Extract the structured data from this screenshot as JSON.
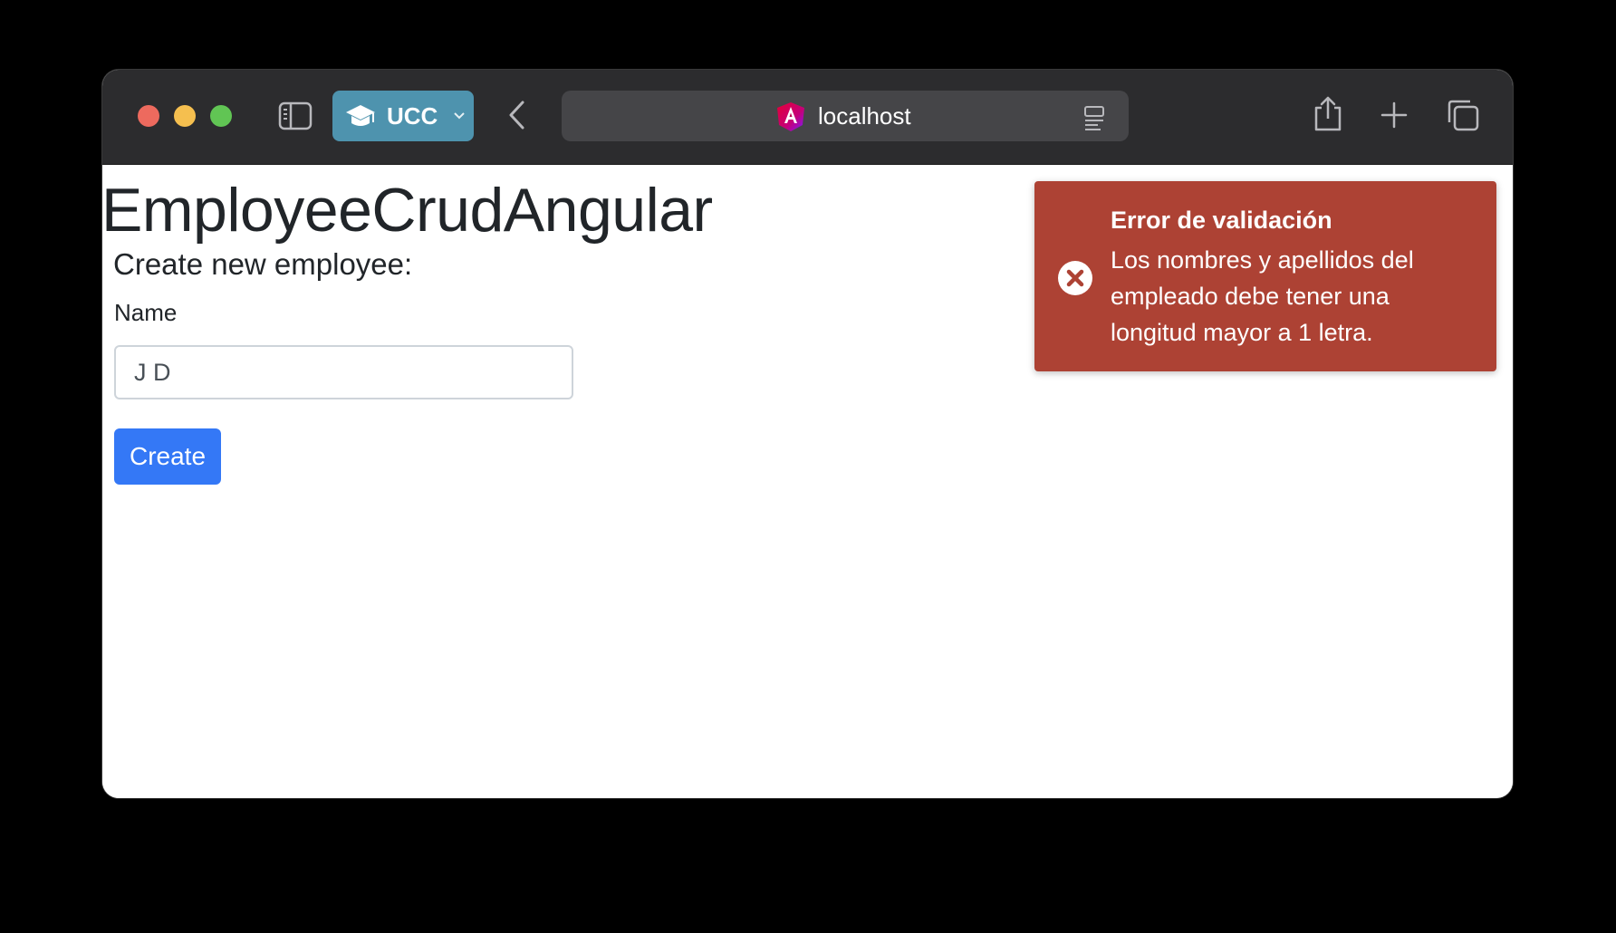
{
  "browser": {
    "profile_label": "UCC",
    "url": "localhost",
    "icons": [
      "sidebar-icon",
      "graduation-cap-icon",
      "chevron-down-icon",
      "back-icon",
      "angular-icon",
      "reader-icon",
      "share-icon",
      "plus-icon",
      "tabs-icon"
    ]
  },
  "page": {
    "app_title": "EmployeeCrudAngular",
    "section_title": "Create new employee:",
    "name_label": "Name",
    "name_value": "J D",
    "create_label": "Create"
  },
  "toast": {
    "title": "Error de validación",
    "message": "Los nombres y apellidos del empleado debe tener una longitud mayor a 1 letra.",
    "icon": "error-circle-icon"
  },
  "colors": {
    "toast_background": "#ad4234",
    "primary_button": "#3478f6",
    "profile_pill": "#4e93ae",
    "titlebar": "#2c2c2e"
  }
}
